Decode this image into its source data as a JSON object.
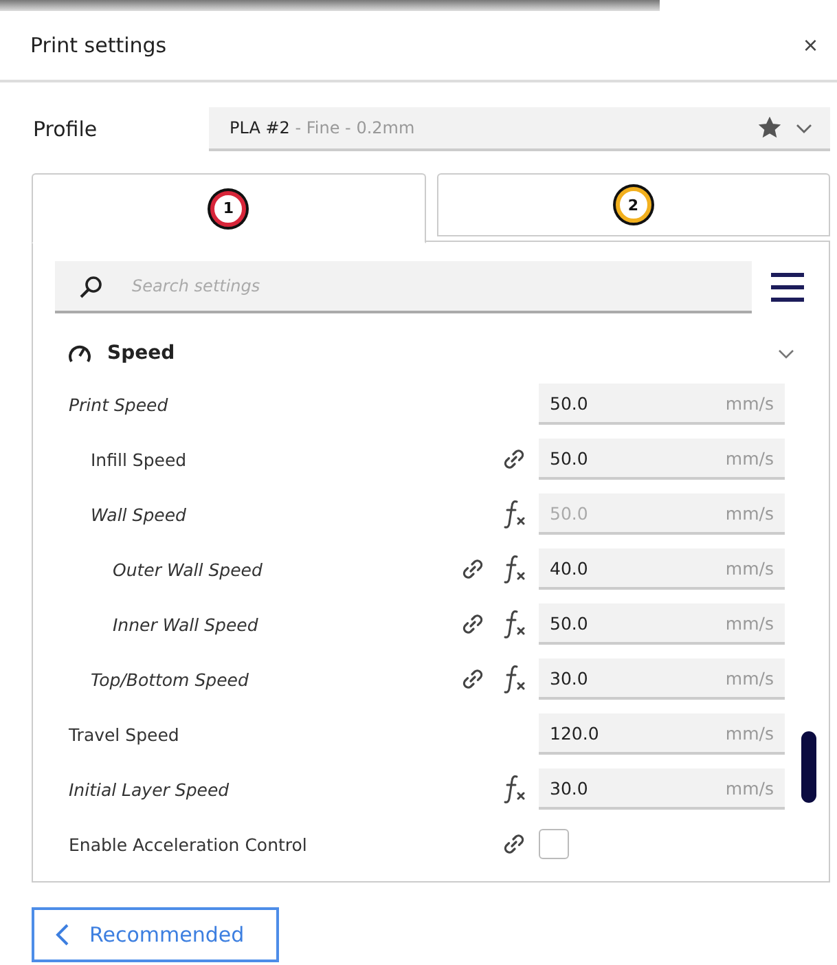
{
  "window": {
    "title": "Print settings",
    "close": "×"
  },
  "profile": {
    "label": "Profile",
    "name": "PLA #2",
    "detail": " - Fine - 0.2mm",
    "favorite": true
  },
  "tabs": [
    {
      "label": "1",
      "selected": true,
      "color": "#d8263a"
    },
    {
      "label": "2",
      "selected": false,
      "color": "#f2b01e"
    }
  ],
  "search": {
    "placeholder": "Search settings"
  },
  "section": {
    "title": "Speed",
    "expanded": true
  },
  "settings": [
    {
      "kind": "number",
      "label": "Print Speed",
      "italic": true,
      "linked": false,
      "formula": false,
      "value": "50.0",
      "unit": "mm/s",
      "disabled": false,
      "children": [
        {
          "kind": "number",
          "label": "Infill Speed",
          "italic": false,
          "linked": true,
          "formula": false,
          "value": "50.0",
          "unit": "mm/s",
          "disabled": false
        },
        {
          "kind": "number",
          "label": "Wall Speed",
          "italic": true,
          "linked": false,
          "formula": true,
          "value": "50.0",
          "unit": "mm/s",
          "disabled": true,
          "children": [
            {
              "kind": "number",
              "label": "Outer Wall Speed",
              "italic": true,
              "linked": true,
              "formula": true,
              "value": "40.0",
              "unit": "mm/s",
              "disabled": false
            },
            {
              "kind": "number",
              "label": "Inner Wall Speed",
              "italic": true,
              "linked": true,
              "formula": true,
              "value": "50.0",
              "unit": "mm/s",
              "disabled": false
            }
          ]
        },
        {
          "kind": "number",
          "label": "Top/Bottom Speed",
          "italic": true,
          "linked": true,
          "formula": true,
          "value": "30.0",
          "unit": "mm/s",
          "disabled": false
        }
      ]
    },
    {
      "kind": "number",
      "label": "Travel Speed",
      "italic": false,
      "linked": false,
      "formula": false,
      "value": "120.0",
      "unit": "mm/s",
      "disabled": false
    },
    {
      "kind": "number",
      "label": "Initial Layer Speed",
      "italic": true,
      "linked": false,
      "formula": true,
      "value": "30.0",
      "unit": "mm/s",
      "disabled": false
    },
    {
      "kind": "checkbox",
      "label": "Enable Acceleration Control",
      "italic": false,
      "linked": true,
      "formula": false,
      "checked": false
    }
  ],
  "footer": {
    "button": "Recommended"
  }
}
